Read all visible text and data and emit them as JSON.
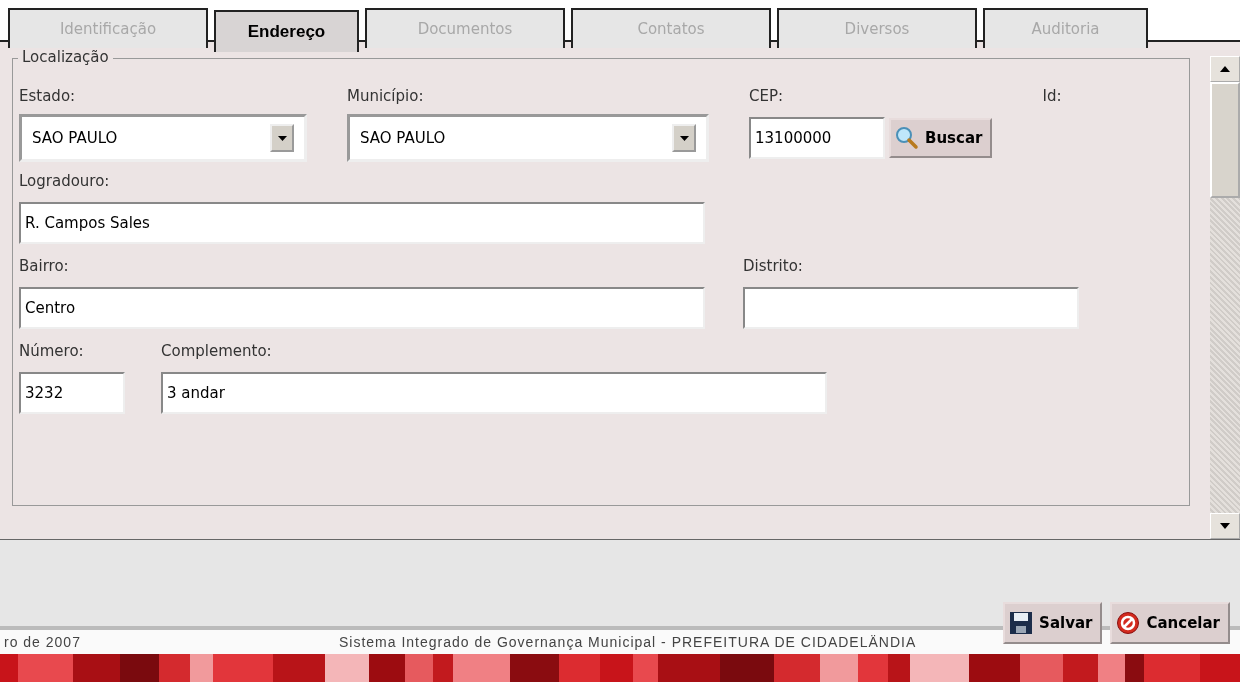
{
  "tabs": [
    {
      "label": "Identificação",
      "selected": false
    },
    {
      "label": "Endereço",
      "selected": true
    },
    {
      "label": "Documentos",
      "selected": false
    },
    {
      "label": "Contatos",
      "selected": false
    },
    {
      "label": "Diversos",
      "selected": false
    },
    {
      "label": "Auditoria",
      "selected": false
    }
  ],
  "fieldset": {
    "legend": "Localização",
    "rows": [
      {
        "fields": [
          {
            "kind": "select",
            "label": "Estado:",
            "value": "SAO PAULO"
          },
          {
            "kind": "select",
            "label": "Município:",
            "value": "SAO PAULO"
          },
          {
            "kind": "cep",
            "label": "CEP:",
            "value": "13100000",
            "button": "Buscar"
          },
          {
            "kind": "label",
            "label": "Id:"
          }
        ]
      },
      {
        "fields": [
          {
            "kind": "text",
            "label": "Logradouro:",
            "value": "R. Campos Sales"
          }
        ]
      },
      {
        "fields": [
          {
            "kind": "text",
            "label": "Bairro:",
            "value": "Centro"
          },
          {
            "kind": "text",
            "label": "Distrito:"
          }
        ]
      },
      {
        "fields": [
          {
            "kind": "text",
            "label": "Número:",
            "value": "3232"
          },
          {
            "kind": "text",
            "label": "Complemento:",
            "value": "3 andar"
          }
        ]
      }
    ]
  },
  "buttons": [
    {
      "kind": "save",
      "label": "Salvar"
    },
    {
      "kind": "cancel",
      "label": "Cancelar"
    }
  ],
  "footer": {
    "left": "ro de 2007",
    "center": "Sistema Integrado de Governança Municipal - PREFEITURA DE CIDADELÄNDIA"
  }
}
